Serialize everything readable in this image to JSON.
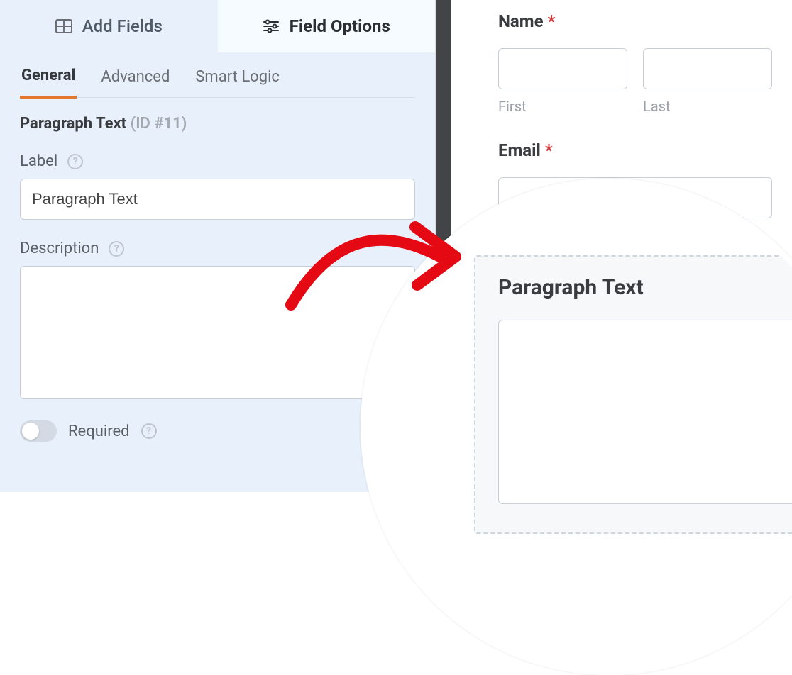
{
  "header_tabs": {
    "add_fields": "Add Fields",
    "field_options": "Field Options"
  },
  "subtabs": {
    "general": "General",
    "advanced": "Advanced",
    "smart_logic": "Smart Logic"
  },
  "field": {
    "type_label": "Paragraph Text",
    "id_text": "(ID #11)"
  },
  "forms": {
    "label_lbl": "Label",
    "label_value": "Paragraph Text",
    "description_lbl": "Description",
    "description_value": "",
    "required_lbl": "Required"
  },
  "preview": {
    "name_label": "Name",
    "first_sub": "First",
    "last_sub": "Last",
    "email_label": "Email",
    "paragraph_label": "Paragraph Text"
  },
  "glyphs": {
    "star": "*",
    "qmark": "?"
  }
}
